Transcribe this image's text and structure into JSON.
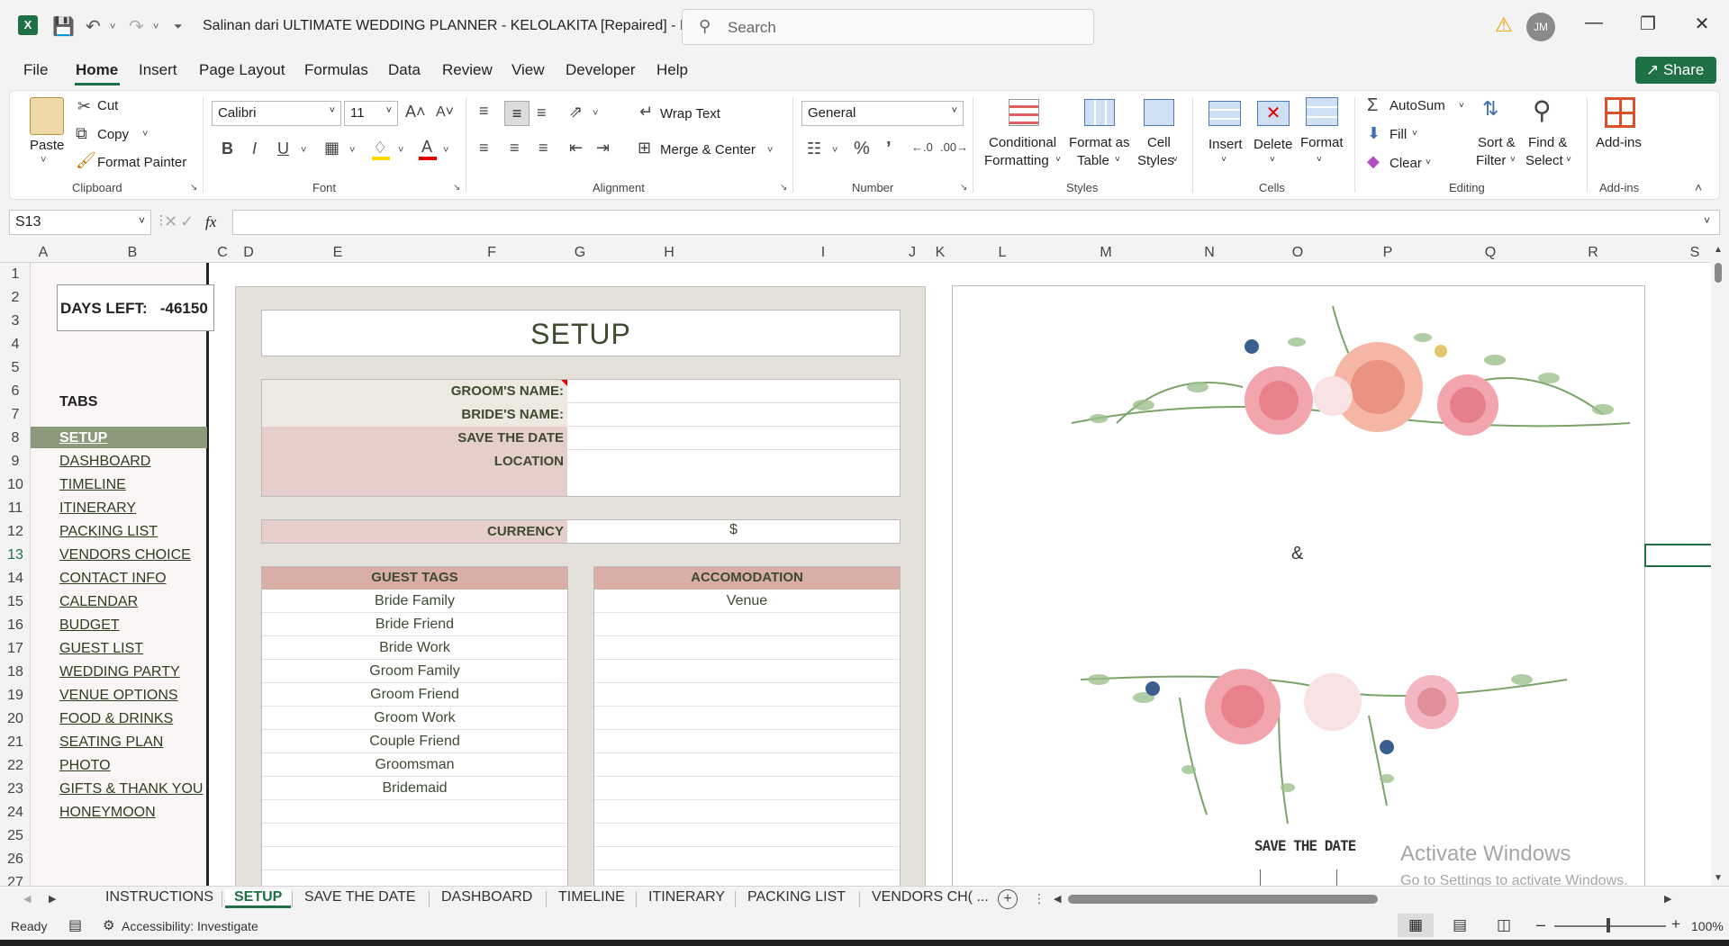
{
  "titlebar": {
    "title": "Salinan dari ULTIMATE WEDDING PLANNER - KELOLAKITA [Repaired]  -  E...",
    "search_placeholder": "Search",
    "avatar_initials": "JM"
  },
  "menu": {
    "file": "File",
    "home": "Home",
    "insert": "Insert",
    "page_layout": "Page Layout",
    "formulas": "Formulas",
    "data": "Data",
    "review": "Review",
    "view": "View",
    "developer": "Developer",
    "help": "Help",
    "share": "Share"
  },
  "ribbon": {
    "clipboard": {
      "paste": "Paste",
      "cut": "Cut",
      "copy": "Copy",
      "format_painter": "Format Painter",
      "label": "Clipboard"
    },
    "font": {
      "family": "Calibri",
      "size": "11",
      "label": "Font"
    },
    "alignment": {
      "wrap_text": "Wrap Text",
      "merge_center": "Merge & Center",
      "label": "Alignment"
    },
    "number": {
      "format": "General",
      "label": "Number"
    },
    "styles": {
      "conditional": "Conditional",
      "conditional2": "Formatting",
      "format_table": "Format as",
      "format_table2": "Table",
      "cell_styles": "Cell",
      "cell_styles2": "Styles",
      "label": "Styles"
    },
    "cells": {
      "insert": "Insert",
      "delete": "Delete",
      "format": "Format",
      "label": "Cells"
    },
    "editing": {
      "autosum": "AutoSum",
      "fill": "Fill",
      "clear": "Clear",
      "sort": "Sort &",
      "sort2": "Filter",
      "find": "Find &",
      "find2": "Select",
      "label": "Editing"
    },
    "addins": {
      "addins": "Add-ins",
      "label": "Add-ins"
    }
  },
  "formula": {
    "name_box": "S13",
    "fx": "fx"
  },
  "columns": [
    "A",
    "B",
    "C",
    "D",
    "E",
    "F",
    "G",
    "H",
    "I",
    "J",
    "K",
    "L",
    "M",
    "N",
    "O",
    "P",
    "Q",
    "R",
    "S"
  ],
  "rows": [
    "1",
    "2",
    "3",
    "4",
    "5",
    "6",
    "7",
    "8",
    "9",
    "10",
    "11",
    "12",
    "13",
    "14",
    "15",
    "16",
    "17",
    "18",
    "19",
    "20",
    "21",
    "22",
    "23",
    "24",
    "25",
    "26",
    "27"
  ],
  "sidebar": {
    "days_left_label": "DAYS LEFT:",
    "days_left_value": "-46150",
    "tabs_heading": "TABS",
    "tabs": [
      "SETUP",
      "DASHBOARD",
      "TIMELINE",
      "ITINERARY",
      "PACKING LIST",
      "VENDORS CHOICE",
      "CONTACT INFO",
      "CALENDAR",
      "BUDGET",
      "GUEST LIST",
      "WEDDING PARTY",
      "VENUE OPTIONS",
      "FOOD & DRINKS",
      "SEATING PLAN",
      "PHOTO",
      "GIFTS & THANK YOU",
      "HONEYMOON"
    ]
  },
  "setup": {
    "title": "SETUP",
    "grooms_name": "GROOM'S NAME:",
    "brides_name": "BRIDE'S NAME:",
    "save_the_date": "SAVE THE DATE",
    "location": "LOCATION",
    "currency_label": "CURRENCY",
    "currency_value": "$",
    "guest_tags_head": "GUEST TAGS",
    "guest_tags": [
      "Bride Family",
      "Bride Friend",
      "Bride Work",
      "Groom Family",
      "Groom Friend",
      "Groom Work",
      "Couple Friend",
      "Groomsman",
      "Bridemaid"
    ],
    "accomodation_head": "ACCOMODATION",
    "accomodation": [
      "Venue"
    ]
  },
  "preview": {
    "ampersand": "&",
    "save_the_date": "SAVE THE DATE"
  },
  "watermark": {
    "line1": "Activate Windows",
    "line2": "Go to Settings to activate Windows."
  },
  "sheet_tabs": [
    "INSTRUCTIONS",
    "SETUP",
    "SAVE THE DATE",
    "DASHBOARD",
    "TIMELINE",
    "ITINERARY",
    "PACKING LIST",
    "VENDORS CH( ..."
  ],
  "status": {
    "ready": "Ready",
    "accessibility": "Accessibility: Investigate",
    "zoom": "100%"
  }
}
